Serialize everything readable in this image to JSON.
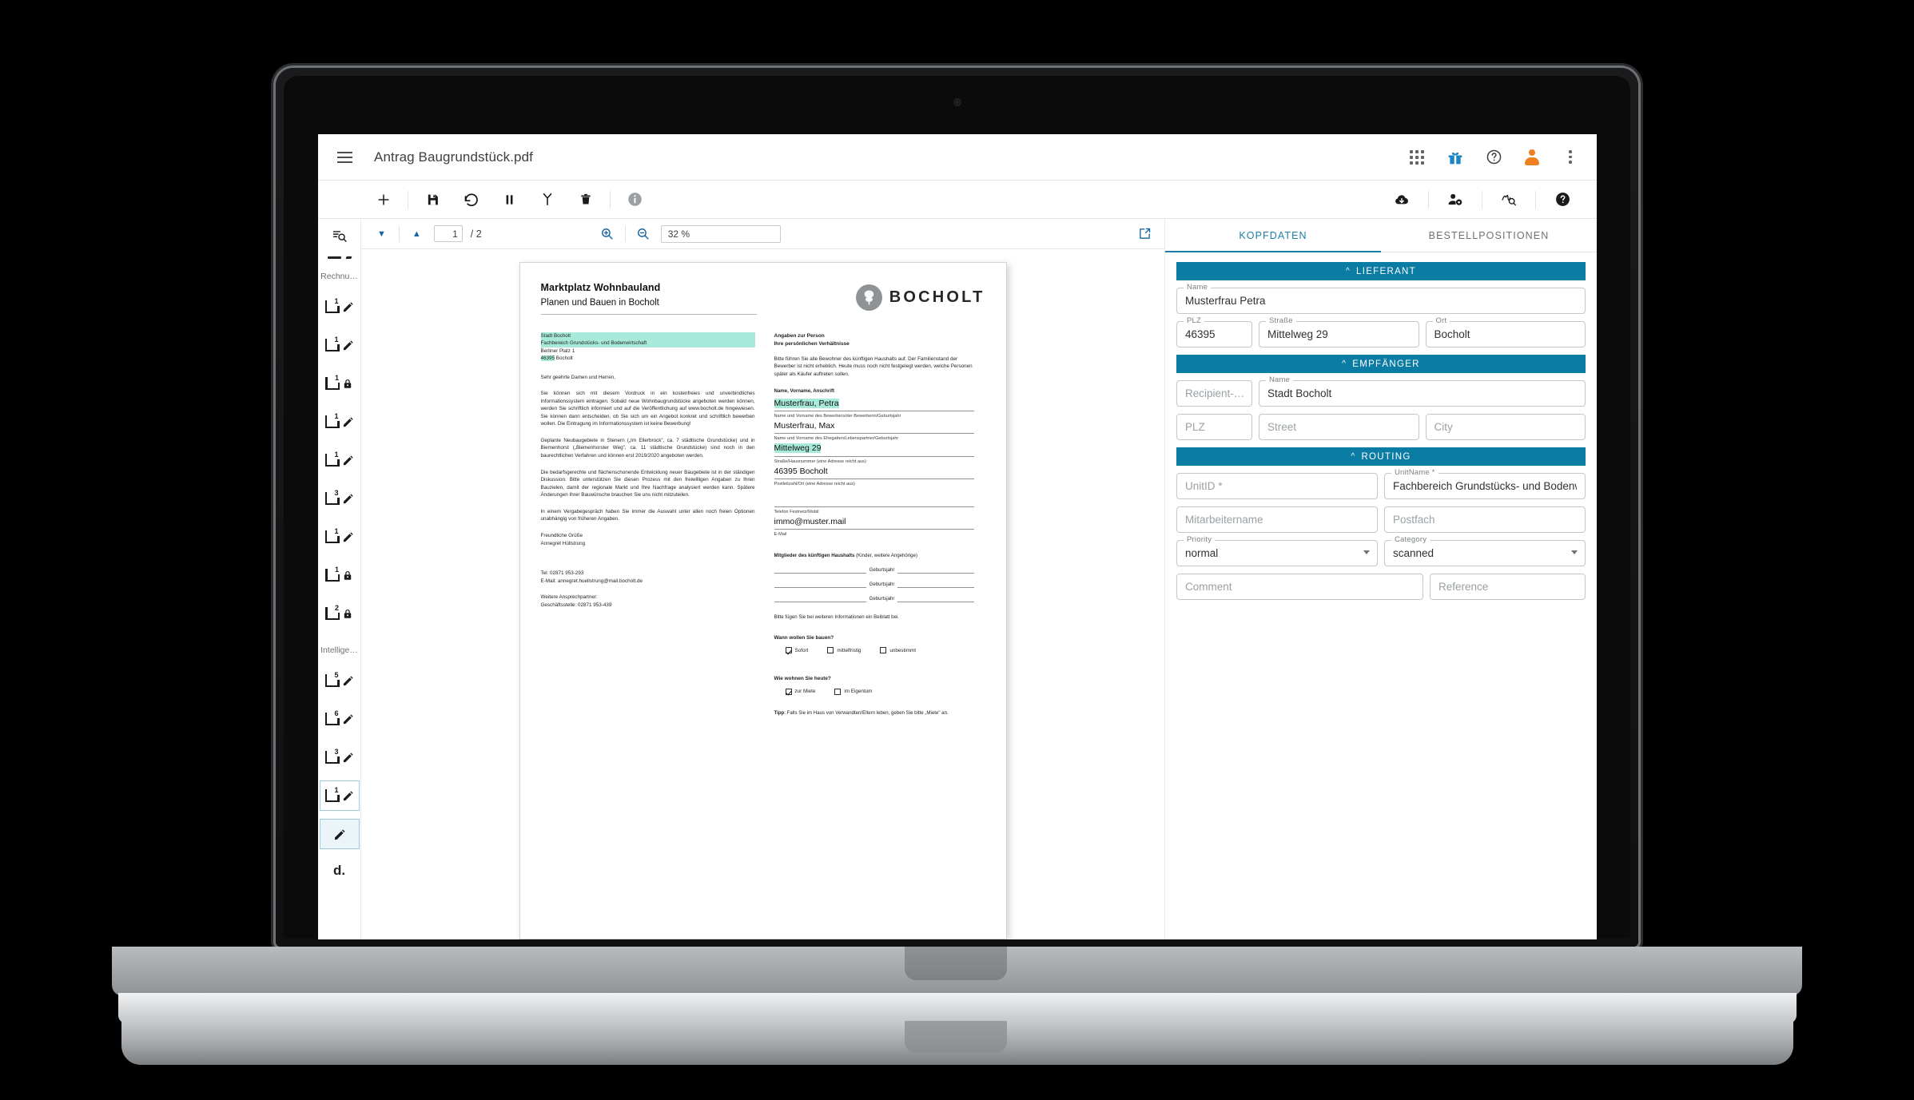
{
  "app": {
    "title": "Antrag Baugrundstück.pdf",
    "menu_icon": "hamburger-icon"
  },
  "appbar_icons": [
    {
      "name": "apps-grid-icon",
      "label": "Apps"
    },
    {
      "name": "gift-icon",
      "label": "What's new"
    },
    {
      "name": "help-circle-icon",
      "label": "Help"
    },
    {
      "name": "user-avatar-icon",
      "label": "Account"
    },
    {
      "name": "more-vertical-icon",
      "label": "More"
    }
  ],
  "toolbar": {
    "left_icons": [
      {
        "name": "add-icon",
        "label": "Add"
      },
      {
        "name": "save-icon",
        "label": "Save"
      },
      {
        "name": "undo-icon",
        "label": "Undo"
      },
      {
        "name": "pause-icon",
        "label": "Pause"
      },
      {
        "name": "split-branch-icon",
        "label": "Split"
      },
      {
        "name": "delete-icon",
        "label": "Delete"
      },
      {
        "name": "info-icon",
        "label": "Info"
      }
    ],
    "right_icons": [
      {
        "name": "cloud-download-icon",
        "label": "Download"
      },
      {
        "name": "user-settings-icon",
        "label": "User settings"
      },
      {
        "name": "signature-search-icon",
        "label": "Verify"
      },
      {
        "name": "help-filled-icon",
        "label": "Help"
      }
    ]
  },
  "rail": {
    "search_icon": "list-search-icon",
    "group_labels": [
      "Rechnu…",
      "Intellige…"
    ],
    "items": [
      {
        "badge": "1",
        "action": "edit"
      },
      {
        "badge": "1",
        "action": "edit"
      },
      {
        "badge": "1",
        "action": "lock"
      },
      {
        "badge": "1",
        "action": "edit"
      },
      {
        "badge": "1",
        "action": "edit"
      },
      {
        "badge": "3",
        "action": "edit"
      },
      {
        "badge": "1",
        "action": "edit"
      },
      {
        "badge": "1",
        "action": "lock"
      },
      {
        "badge": "2",
        "action": "lock"
      },
      {
        "badge": "5",
        "action": "edit"
      },
      {
        "badge": "6",
        "action": "edit"
      },
      {
        "badge": "3",
        "action": "edit"
      },
      {
        "badge": "1",
        "action": "edit"
      }
    ],
    "bottom_label": "d."
  },
  "viewer": {
    "prev_icon": "caret-down-icon",
    "next_icon": "caret-up-icon",
    "page_current": "1",
    "page_total": "/ 2",
    "zoom_in_icon": "zoom-in-icon",
    "zoom_out_icon": "zoom-out-icon",
    "zoom_value": "32 %",
    "popout_icon": "open-external-icon"
  },
  "document": {
    "title_line1": "Marktplatz Wohnbauland",
    "title_line2": "Planen und Bauen in Bocholt",
    "brand": "BOCHOLT",
    "brand_logo": "tree-in-circle-icon",
    "address": {
      "line1": "Stadt Bocholt",
      "line2": "Fachbereich Grundstücks- und Bodenwirtschaft",
      "line3": "Berliner Platz 1",
      "line4_zip": "46395",
      "line4_city": " Bocholt"
    },
    "salutation": "Sehr geehrte Damen und Herren,",
    "paragraphs": [
      "Sie können sich mit diesem Vordruck in ein kostenfreies und unverbindliches Informationssystem eintragen. Sobald neue Wohnbaugrundstücke angeboten werden können, werden Sie schriftlich informiert und auf die Veröffentlichung auf www.bocholt.de hingewiesen. Sie können dann entscheiden, ob Sie sich um ein Angebot konkret und schriftlich bewerben wollen. Die Eintragung im Informationssystem ist keine Bewerbung!",
      "Geplante Neubaugebiete in Stenern („Im Ellerbrock\", ca. 7 städtische Grundstücke) und in Biemenhorst („Biemenhorster Weg\", ca. 11 städtische Grundstücke) sind noch in den baurechtlichen Verfahren und können erst 2019/2020 angeboten werden.",
      "Die bedarfsgerechte und flächenschonende Entwicklung neuer Baugebiete ist in der ständigen Diskussion. Bitte unterstützen Sie diesen Prozess mit den freiwilligen Angaben zu Ihren Bauzielen, damit der regionale Markt und Ihre Nachfrage analysiert werden kann. Spätere Änderungen Ihrer Bauwünsche brauchen Sie uns nicht mitzuteilen.",
      "In einem Vergabegespräch haben Sie immer die Auswahl unter allen noch freien Optionen unabhängig von früheren Angaben."
    ],
    "closing_line1": "Freundliche Grüße",
    "closing_line2": "Annegret Hüllstrung",
    "contact_tel": "Tel: 02871 953-293",
    "contact_mail": "E-Mail: annegret.huellstrung@mail.bocholt.de",
    "contact_more_label": "Weitere Ansprechpartner:",
    "contact_more_value": "Geschäftsstelle: 02871 953-439",
    "right": {
      "head1": "Angaben zur Person",
      "head2": "Ihre persönlichen Verhältnisse",
      "intro": "Bitte führen Sie alle Bewohner des künftigen Haushalts auf. Der Familienstand der Bewerber ist nicht erheblich. Heute muss noch nicht festgelegt werden, welche Personen später als Käufer auftreten sollen.",
      "section_label": "Name, Vorname, Anschrift",
      "fields": [
        {
          "value": "Musterfrau, Petra",
          "hint": "Name und Vorname des Bewerbers/der Bewerberin/Geburtsjahr",
          "highlight": true
        },
        {
          "value": "Musterfrau, Max",
          "hint": "Name und Vorname des Ehegatten/Lebenspartner/Geburtsjahr",
          "highlight": false
        },
        {
          "value": "Mittelweg 29",
          "hint": "Straße/Hausnummer (eine Adresse reicht aus)",
          "highlight": true
        },
        {
          "value": "46395 Bocholt",
          "hint": "Postleitzahl/Ort (eine Adresse reicht aus)",
          "highlight": false
        },
        {
          "value": "",
          "hint": "Telefon Festnetz/Mobil",
          "highlight": false
        },
        {
          "value": "immo@muster.mail",
          "hint": "E-Mail",
          "highlight": false
        }
      ],
      "household_label_bold": "Mitglieder des künftigen Haushalts",
      "household_label_rest": " (Kinder, weitere Angehörige)",
      "birthyear_label": "Geburtsjahr",
      "attachment_note": "Bitte fügen Sie bei weiteren Informationen ein Beiblatt bei.",
      "q1": "Wann wollen Sie bauen?",
      "q1_options": [
        {
          "label": "Sofort",
          "checked": true
        },
        {
          "label": "mittelfristig",
          "checked": false
        },
        {
          "label": "unbestimmt",
          "checked": false
        }
      ],
      "q2": "Wie wohnen Sie heute?",
      "q2_options": [
        {
          "label": "zur Miete",
          "checked": true
        },
        {
          "label": "im Eigentum",
          "checked": false
        }
      ],
      "tip_bold": "Tipp",
      "tip_rest": ": Falls Sie im Haus von Verwandten/Eltern leben, geben Sie bitte „Miete\" an."
    }
  },
  "form": {
    "tabs": [
      {
        "label": "KOPFDATEN",
        "active": true
      },
      {
        "label": "BESTELLPOSITIONEN",
        "active": false
      }
    ],
    "accent_color": "#0b7ca3",
    "sections": [
      {
        "title": "LIEFERANT",
        "rows": [
          [
            {
              "label": "Name",
              "value": "Musterfrau Petra",
              "placeholder": "",
              "width": "wide"
            }
          ],
          [
            {
              "label": "PLZ",
              "value": "46395",
              "placeholder": "",
              "width": "plz"
            },
            {
              "label": "Straße",
              "value": "Mittelweg 29",
              "placeholder": "",
              "width": "half"
            },
            {
              "label": "Ort",
              "value": "Bocholt",
              "placeholder": "",
              "width": "half"
            }
          ]
        ]
      },
      {
        "title": "EMPFÄNGER",
        "rows": [
          [
            {
              "label": "",
              "value": "",
              "placeholder": "Recipient-…",
              "width": "rec"
            },
            {
              "label": "Name",
              "value": "Stadt Bocholt",
              "placeholder": "",
              "width": "wide"
            }
          ],
          [
            {
              "label": "",
              "value": "",
              "placeholder": "PLZ",
              "width": "plz"
            },
            {
              "label": "",
              "value": "",
              "placeholder": "Street",
              "width": "half"
            },
            {
              "label": "",
              "value": "",
              "placeholder": "City",
              "width": "half"
            }
          ]
        ]
      },
      {
        "title": "ROUTING",
        "rows": [
          [
            {
              "label": "",
              "value": "",
              "placeholder": "UnitID *",
              "width": "half"
            },
            {
              "label": "UnitName *",
              "value": "Fachbereich Grundstücks- und Bodenwirtschaft",
              "placeholder": "",
              "width": "half"
            }
          ],
          [
            {
              "label": "",
              "value": "",
              "placeholder": "Mitarbeitername",
              "width": "half"
            },
            {
              "label": "",
              "value": "",
              "placeholder": "Postfach",
              "width": "half"
            }
          ],
          [
            {
              "label": "Priority",
              "value": "normal",
              "placeholder": "",
              "width": "half",
              "select": true
            },
            {
              "label": "Category",
              "value": "scanned",
              "placeholder": "",
              "width": "half",
              "select": true
            }
          ],
          [
            {
              "label": "",
              "value": "",
              "placeholder": "Comment",
              "width": "wide"
            },
            {
              "label": "",
              "value": "",
              "placeholder": "Reference",
              "width": "ref"
            }
          ]
        ]
      }
    ]
  }
}
